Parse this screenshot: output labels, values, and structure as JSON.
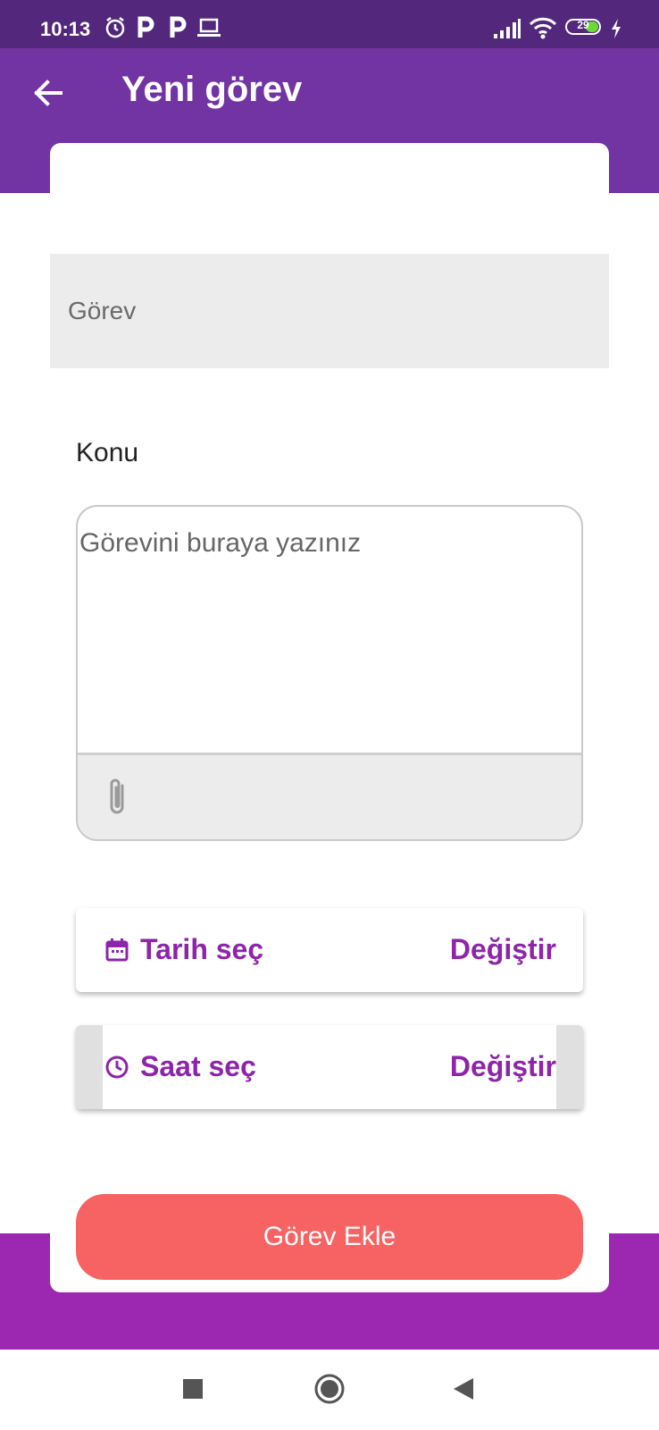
{
  "status_bar": {
    "time": "10:13",
    "battery_level": "29",
    "icons": [
      "alarm-icon",
      "parking-icon",
      "parking-icon",
      "laptop-icon",
      "signal-icon",
      "wifi-icon",
      "battery-icon",
      "charging-icon"
    ]
  },
  "app_bar": {
    "title": "Yeni görev",
    "back_icon": "arrow-left-icon"
  },
  "form": {
    "title_placeholder": "Görev",
    "subject_label": "Konu",
    "description_placeholder": "Görevini buraya yazınız",
    "attach_icon": "paperclip-icon",
    "date": {
      "label": "Tarih seç",
      "change_label": "Değiştir",
      "icon": "calendar-icon"
    },
    "time": {
      "label": "Saat seç",
      "change_label": "Değiştir",
      "icon": "clock-icon"
    },
    "submit_label": "Görev Ekle"
  },
  "colors": {
    "status_bar": "#53287c",
    "app_bar": "#7234a3",
    "bottom_band": "#9c27b0",
    "accent": "#8e24aa",
    "submit_button": "#f76262"
  },
  "nav_bar": {
    "items": [
      "recent-apps-icon",
      "home-icon",
      "back-icon"
    ]
  }
}
